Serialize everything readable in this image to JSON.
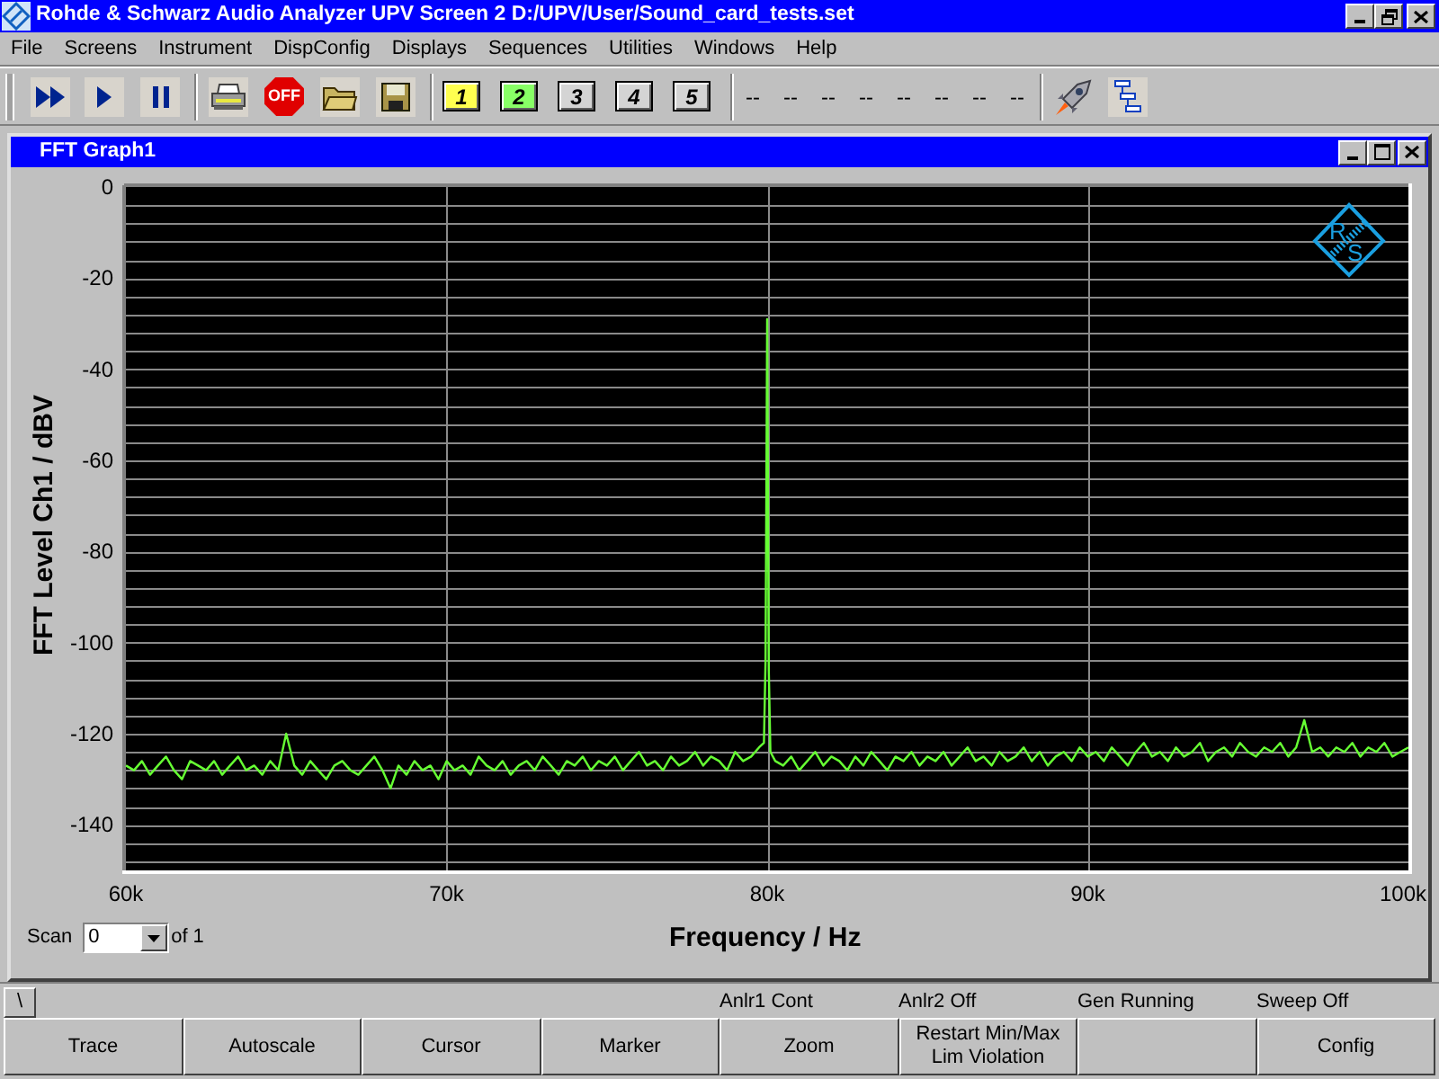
{
  "window": {
    "title": "Rohde & Schwarz Audio Analyzer UPV Screen 2 D:/UPV/User/Sound_card_tests.set"
  },
  "menu": [
    "File",
    "Screens",
    "Instrument",
    "DispConfig",
    "Displays",
    "Sequences",
    "Utilities",
    "Windows",
    "Help"
  ],
  "toolbar": {
    "off_label": "OFF",
    "screens": [
      {
        "label": "1",
        "color": "#ffff50"
      },
      {
        "label": "2",
        "color": "#88ff66"
      },
      {
        "label": "3",
        "color": "#d4d4d4"
      },
      {
        "label": "4",
        "color": "#d4d4d4"
      },
      {
        "label": "5",
        "color": "#d4d4d4"
      }
    ],
    "slots": [
      "--",
      "--",
      "--",
      "--",
      "--",
      "--",
      "--",
      "--"
    ]
  },
  "graph_window": {
    "title": "FFT Graph1",
    "logo": {
      "letters": [
        "R",
        "S"
      ]
    },
    "chart_data": {
      "type": "line",
      "grid": true,
      "xlabel": "Frequency / Hz",
      "ylabel": "FFT Level Ch1 / dBV",
      "xlim": [
        60000,
        100000
      ],
      "ylim": [
        -150,
        0
      ],
      "xticks": [
        {
          "value": 60000,
          "label": "60k"
        },
        {
          "value": 70000,
          "label": "70k"
        },
        {
          "value": 80000,
          "label": "80k"
        },
        {
          "value": 90000,
          "label": "90k"
        },
        {
          "value": 100000,
          "label": "100k"
        }
      ],
      "yticks": [
        0,
        -20,
        -40,
        -60,
        -80,
        -100,
        -120,
        -140
      ],
      "x": [
        60000,
        60250,
        60500,
        60750,
        61000,
        61250,
        61500,
        61750,
        62000,
        62250,
        62500,
        62750,
        63000,
        63250,
        63500,
        63750,
        64000,
        64250,
        64500,
        64750,
        65000,
        65250,
        65500,
        65750,
        66000,
        66250,
        66500,
        66750,
        67000,
        67250,
        67500,
        67750,
        68000,
        68250,
        68500,
        68750,
        69000,
        69250,
        69500,
        69750,
        70000,
        70250,
        70500,
        70750,
        71000,
        71250,
        71500,
        71750,
        72000,
        72250,
        72500,
        72750,
        73000,
        73250,
        73500,
        73750,
        74000,
        74250,
        74500,
        74750,
        75000,
        75250,
        75500,
        75750,
        76000,
        76250,
        76500,
        76750,
        77000,
        77250,
        77500,
        77750,
        78000,
        78250,
        78500,
        78750,
        79000,
        79250,
        79500,
        79750,
        79900,
        79950,
        80000,
        80050,
        80100,
        80250,
        80500,
        80750,
        81000,
        81250,
        81500,
        81750,
        82000,
        82250,
        82500,
        82750,
        83000,
        83250,
        83500,
        83750,
        84000,
        84250,
        84500,
        84750,
        85000,
        85250,
        85500,
        85750,
        86000,
        86250,
        86500,
        86750,
        87000,
        87250,
        87500,
        87750,
        88000,
        88250,
        88500,
        88750,
        89000,
        89250,
        89500,
        89750,
        90000,
        90250,
        90500,
        90750,
        91000,
        91250,
        91500,
        91750,
        92000,
        92250,
        92500,
        92750,
        93000,
        93250,
        93500,
        93750,
        94000,
        94250,
        94500,
        94750,
        95000,
        95250,
        95500,
        95750,
        96000,
        96250,
        96500,
        96750,
        97000,
        97250,
        97500,
        97750,
        98000,
        98250,
        98500,
        98750,
        99000,
        99250,
        99500,
        99750,
        100000
      ],
      "series": [
        {
          "color": "#66ff33",
          "values": [
            -127,
            -128,
            -126,
            -129,
            -127,
            -125,
            -128,
            -130,
            -126,
            -127,
            -128,
            -126,
            -129,
            -127,
            -125,
            -128,
            -127,
            -129,
            -126,
            -128,
            -120,
            -127,
            -129,
            -126,
            -128,
            -130,
            -127,
            -126,
            -128,
            -129,
            -127,
            -125,
            -128,
            -132,
            -127,
            -129,
            -126,
            -128,
            -127,
            -130,
            -126,
            -128,
            -127,
            -129,
            -125,
            -127,
            -128,
            -126,
            -129,
            -127,
            -126,
            -128,
            -125,
            -127,
            -129,
            -126,
            -127,
            -125,
            -128,
            -126,
            -127,
            -125,
            -128,
            -126,
            -124,
            -127,
            -126,
            -128,
            -125,
            -127,
            -126,
            -124,
            -127,
            -125,
            -126,
            -128,
            -124,
            -126,
            -125,
            -123,
            -122,
            -104,
            -29,
            -106,
            -124,
            -126,
            -127,
            -125,
            -128,
            -126,
            -124,
            -127,
            -125,
            -126,
            -128,
            -125,
            -127,
            -124,
            -126,
            -128,
            -125,
            -126,
            -124,
            -127,
            -125,
            -126,
            -124,
            -127,
            -125,
            -123,
            -126,
            -125,
            -127,
            -124,
            -126,
            -125,
            -123,
            -126,
            -124,
            -127,
            -125,
            -124,
            -126,
            -123,
            -125,
            -124,
            -126,
            -123,
            -125,
            -127,
            -124,
            -122,
            -125,
            -124,
            -126,
            -123,
            -125,
            -124,
            -122,
            -126,
            -124,
            -123,
            -125,
            -122,
            -124,
            -125,
            -123,
            -124,
            -122,
            -125,
            -123,
            -117,
            -124,
            -123,
            -125,
            -123,
            -124,
            -122,
            -125,
            -123,
            -124,
            -122,
            -125,
            -124,
            -123
          ]
        }
      ]
    },
    "scan": {
      "label": "Scan",
      "value": "0",
      "suffix": "of 1"
    }
  },
  "status": [
    "Anlr1 Cont",
    "Anlr2 Off",
    "Gen Running",
    "Sweep Off"
  ],
  "tab": "\\",
  "softkeys": [
    {
      "kind": "text",
      "lines": [
        "Trace"
      ]
    },
    {
      "kind": "text",
      "lines": [
        "Autoscale"
      ]
    },
    {
      "kind": "text",
      "lines": [
        "Cursor"
      ]
    },
    {
      "kind": "text",
      "lines": [
        "Marker"
      ]
    },
    {
      "kind": "text",
      "lines": [
        "Zoom"
      ]
    },
    {
      "kind": "text",
      "lines": [
        "Restart Min/Max",
        "Lim Violation"
      ]
    },
    {
      "kind": "blank"
    },
    {
      "kind": "text",
      "lines": [
        "Config"
      ]
    }
  ]
}
